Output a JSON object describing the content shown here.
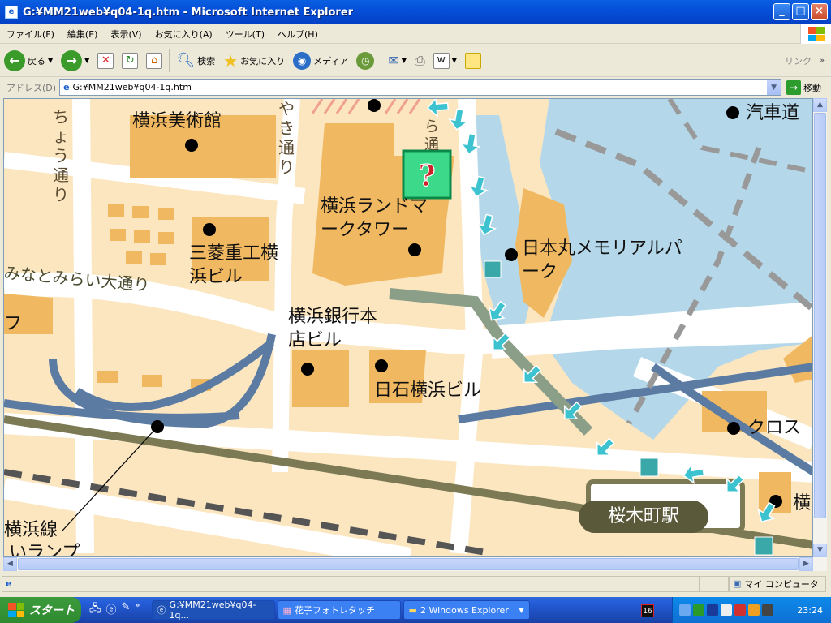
{
  "window": {
    "title": "G:¥MM21web¥q04-1q.htm - Microsoft Internet Explorer"
  },
  "menu": [
    "ファイル(F)",
    "編集(E)",
    "表示(V)",
    "お気に入り(A)",
    "ツール(T)",
    "ヘルプ(H)"
  ],
  "toolbar": {
    "back": "戻る",
    "search": "検索",
    "favorites": "お気に入り",
    "media": "メディア",
    "links": "リンク"
  },
  "address": {
    "label": "アドレス(D)",
    "value": "G:¥MM21web¥q04-1q.htm",
    "go": "移動"
  },
  "map": {
    "labels": {
      "art_museum": "横浜美術館",
      "street_a": "ちょう通り",
      "street_b": "やき通り",
      "street_c": "ら通",
      "landmark": "横浜ランドマークタワー",
      "mitsubishi": "三菱重工横浜ビル",
      "minatomirai": "みなとみらい大通り",
      "nippon_maru": "日本丸メモリアルパーク",
      "bank": "横浜銀行本店ビル",
      "nisseki": "日石横浜ビル",
      "kisha": "汽車道",
      "cross": "クロス",
      "station": "桜木町駅",
      "line_a": "横浜線",
      "line_b": "いランプ",
      "fu": "フ",
      "yoko": "横"
    },
    "colors": {
      "land": "#FBE6C0",
      "building": "#F0B860",
      "road": "#FFFFFF",
      "water": "#B4D8EA",
      "rail": "#7B7A54",
      "arrow": "#3DC3CF"
    }
  },
  "status": {
    "zone": "マイ コンピュータ"
  },
  "taskbar": {
    "start": "スタート",
    "tasks": [
      "G:¥MM21web¥q04-1q...",
      "花子フォトレタッチ",
      "2 Windows Explorer"
    ],
    "time": "23:24",
    "tray_badge": "16"
  }
}
